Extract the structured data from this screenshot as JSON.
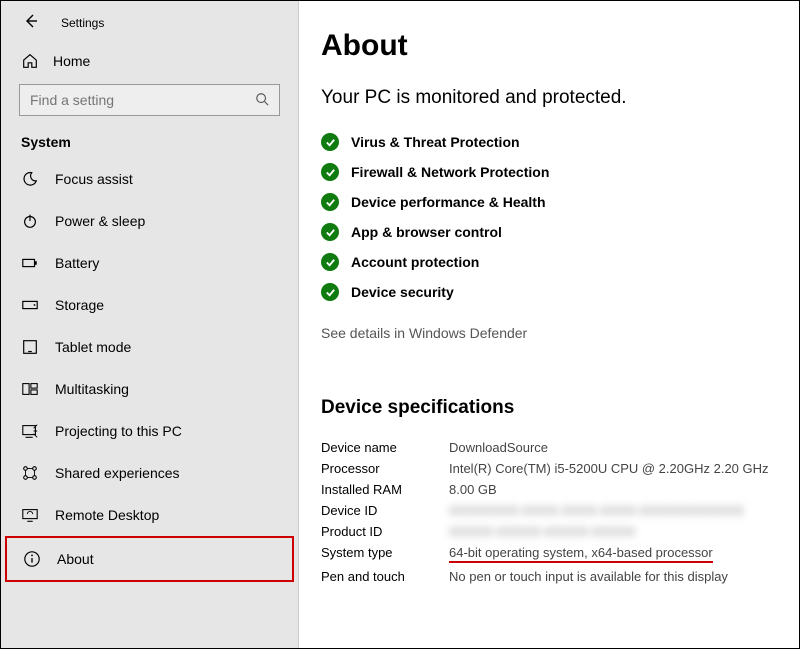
{
  "header": {
    "settings": "Settings"
  },
  "sidebar": {
    "home": "Home",
    "search_placeholder": "Find a setting",
    "section": "System",
    "items": [
      {
        "label": "Focus assist"
      },
      {
        "label": "Power & sleep"
      },
      {
        "label": "Battery"
      },
      {
        "label": "Storage"
      },
      {
        "label": "Tablet mode"
      },
      {
        "label": "Multitasking"
      },
      {
        "label": "Projecting to this PC"
      },
      {
        "label": "Shared experiences"
      },
      {
        "label": "Remote Desktop"
      },
      {
        "label": "About"
      }
    ]
  },
  "main": {
    "title": "About",
    "subtitle": "Your PC is monitored and protected.",
    "protection": [
      "Virus & Threat Protection",
      "Firewall & Network Protection",
      "Device performance & Health",
      "App & browser control",
      "Account protection",
      "Device security"
    ],
    "defender_link": "See details in Windows Defender",
    "spec_heading": "Device specifications",
    "specs": {
      "device_name_label": "Device name",
      "device_name": "DownloadSource",
      "processor_label": "Processor",
      "processor": "Intel(R) Core(TM) i5-5200U CPU @ 2.20GHz   2.20 GHz",
      "ram_label": "Installed RAM",
      "ram": "8.00 GB",
      "device_id_label": "Device ID",
      "device_id": "XXXXXXXX-XXXX-XXXX-XXXX-XXXXXXXXXXXX",
      "product_id_label": "Product ID",
      "product_id": "XXXXX-XXXXX-XXXXX-XXXXX",
      "system_type_label": "System type",
      "system_type": "64-bit operating system, x64-based processor",
      "pen_touch_label": "Pen and touch",
      "pen_touch": "No pen or touch input is available for this display"
    }
  }
}
